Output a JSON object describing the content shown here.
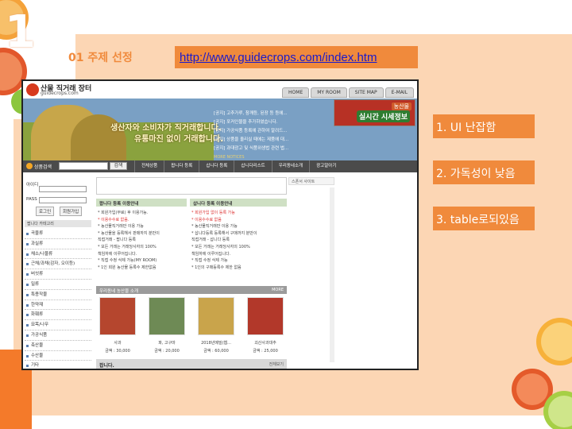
{
  "slide": {
    "number": "1",
    "title": "01 주제 선정",
    "url": "http://www.guidecrops.com/index.htm",
    "notes": [
      "1. UI 난잡함",
      "2. 가독성이 낮음",
      "3. table로되있음"
    ]
  },
  "site": {
    "logo": {
      "badge": "산물",
      "name": "산물 직거래 장터",
      "domain": "guidecrops.com"
    },
    "top_tabs": [
      "HOME",
      "MY ROOM",
      "SITE MAP",
      "E-MAIL"
    ],
    "banner": {
      "slogan_line1": "생산자와 소비자가 직거래합니다.",
      "slogan_line2": "유통마진 없이 거래합니다.",
      "notices": [
        "[공지] 고추가루, 참깨등, 된장 등 등에...",
        "[공지] 포커인물을 추가하였습니다.",
        "[공지] 가공식품 등록에 관하여 알려드...",
        "[공지] 상품을 올리실 때에는 제품에 대...",
        "[공지] 과대광고 및 식품위생법 관련 법..."
      ],
      "more": "MORE NOTICES"
    },
    "ad": {
      "label": "농산물",
      "text": "실시간 시세정보"
    },
    "nav": {
      "search_label": "상품검색",
      "search_button": "검색",
      "items": [
        "전체상품",
        "팝니다 등록",
        "삽니다 등록",
        "삽니다리스트",
        "우리동네소개",
        "광고알아기"
      ]
    },
    "login": {
      "id_label": "아이디",
      "pass_label": "PASS",
      "login_button": "로그인",
      "join_button": "회원가입"
    },
    "categories": {
      "header": "팝니다 카테고리",
      "items": [
        "곡물류",
        "과실류",
        "채소/나물류",
        "근채/과채(감자, 오이등)",
        "버섯류",
        "밀류",
        "특용작물",
        "한약재",
        "화훼류",
        "묘목/나무",
        "가공식품",
        "축산물",
        "수산물",
        "기타"
      ]
    },
    "sell_info": {
      "header": "팝니다 등록 이용안내",
      "lines": [
        {
          "text": "* 회원가입(무료) 후 이용가능.",
          "red": false
        },
        {
          "text": "* 이용수수료 없음.",
          "red": true
        },
        {
          "text": "* 농산물직거래만 이용 가능",
          "red": false
        },
        {
          "text": "* 농산물을 등록해서 판매까지 분만이",
          "red": false
        },
        {
          "text": "  직접거래 - 팝니다 등록",
          "red": false
        },
        {
          "text": "* 모든 거래는 거래당사자의 100%",
          "red": false
        },
        {
          "text": "  책임하에 이루어집니다.",
          "red": false
        },
        {
          "text": "* 직접 수정 삭제 가능(MY ROOM)",
          "red": false
        },
        {
          "text": "* 1인 회원 농산물 등록수 제한없음",
          "red": false
        }
      ]
    },
    "buy_info": {
      "header": "삽니다 등록 이용안내",
      "lines": [
        {
          "text": "* 회원가입 없이 등록 가능",
          "red": true
        },
        {
          "text": "* 이용수수료 없음",
          "red": true
        },
        {
          "text": "* 농산물직거래만 이용 가능",
          "red": false
        },
        {
          "text": "* 삽니다등록 등록해서 구매까지 분만이",
          "red": false
        },
        {
          "text": "  직접거래 - 삽니다 등록",
          "red": false
        },
        {
          "text": "* 모든 거래는 거래당사자의 100%",
          "red": false
        },
        {
          "text": "  책임하에 이루어집니다.",
          "red": false
        },
        {
          "text": "* 직접 수정 삭제 가능",
          "red": false
        },
        {
          "text": "* 1인의 구매등록수 제한 없음",
          "red": false
        }
      ]
    },
    "products_header": "우리동네 농산물 소개",
    "products_more": "MORE",
    "products": [
      {
        "name": "사과",
        "price": "금액 : 30,000",
        "color": "#b5462e"
      },
      {
        "name": "파, 고구마",
        "price": "금액 : 20,000",
        "color": "#6e8a55"
      },
      {
        "name": "2018년메밀(햅...",
        "price": "금액 : 60,000",
        "color": "#c9a44b"
      },
      {
        "name": "괴산사과대추",
        "price": "금액 : 25,000",
        "color": "#b2382a"
      }
    ],
    "bottom_header": "팝니다.",
    "bottom_more": "전체보기",
    "right_header": "스폰서 사이트"
  }
}
